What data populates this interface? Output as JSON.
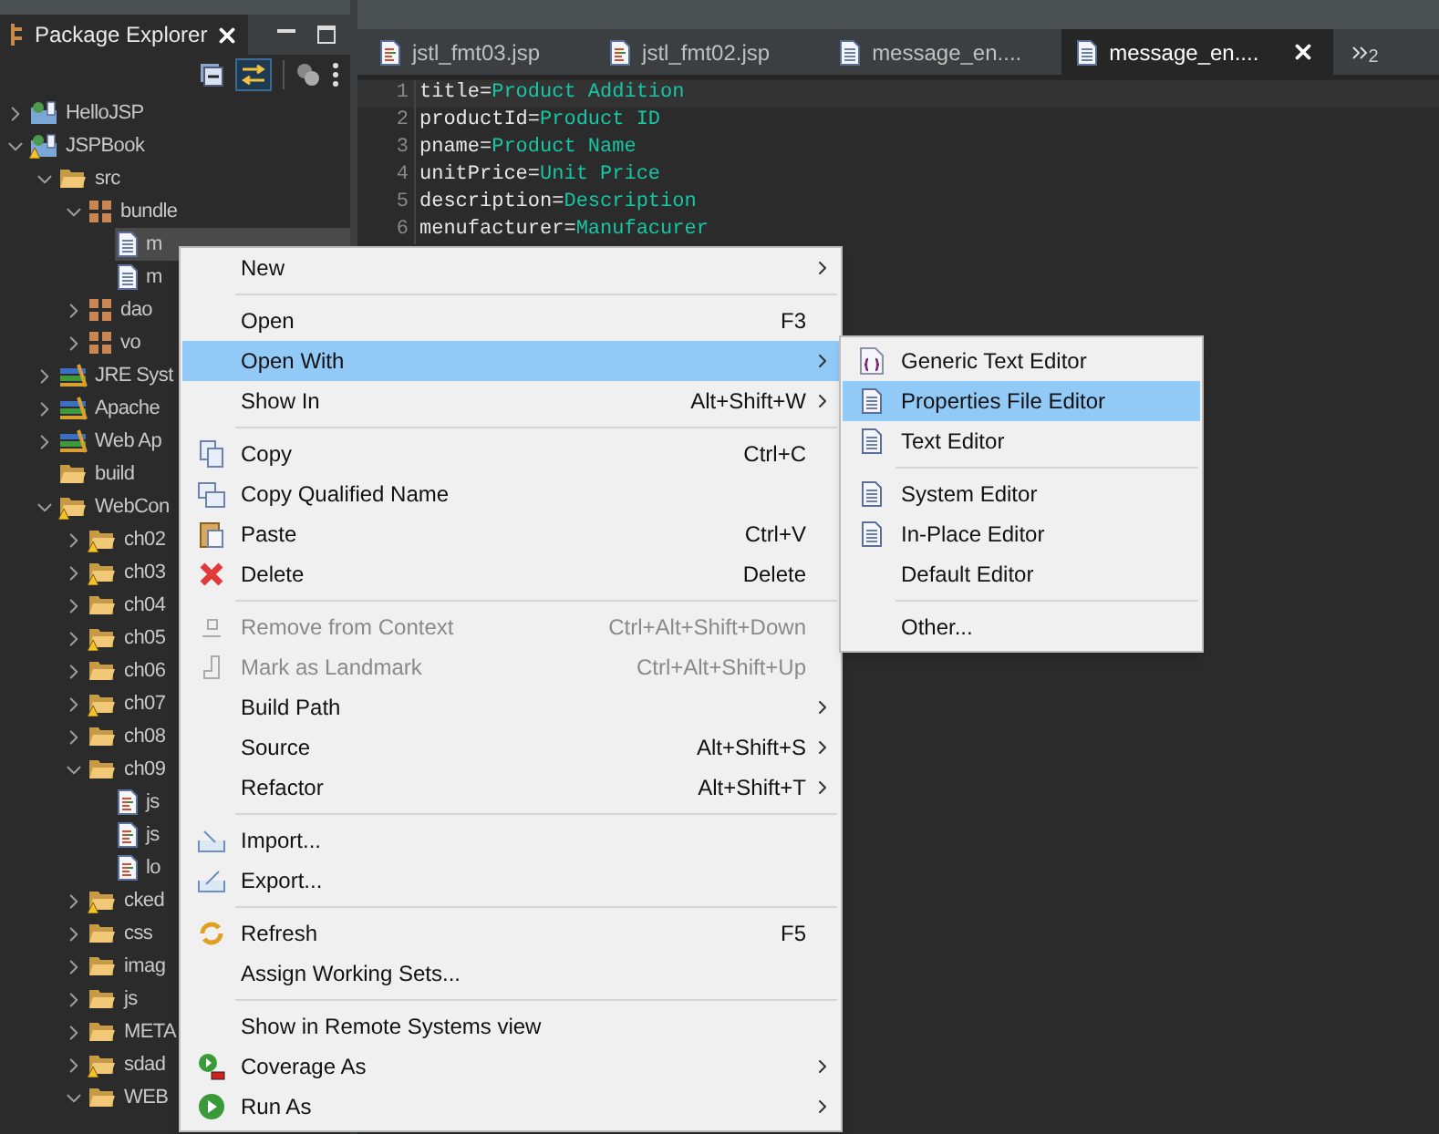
{
  "explorer": {
    "title": "Package Explorer",
    "tree": [
      {
        "label": "HelloJSP",
        "kind": "project",
        "expanded": false,
        "warning": false,
        "selected": false
      },
      {
        "label": "JSPBook",
        "kind": "project",
        "expanded": true,
        "warning": true,
        "selected": false,
        "children": [
          {
            "label": "src",
            "kind": "source-folder",
            "expanded": true,
            "warning": false,
            "selected": false,
            "children": [
              {
                "label": "bundle",
                "kind": "package",
                "expanded": true,
                "selected": false,
                "children": [
                  {
                    "label": "m",
                    "kind": "properties",
                    "selected": true
                  },
                  {
                    "label": "m",
                    "kind": "properties",
                    "selected": false
                  }
                ]
              },
              {
                "label": "dao",
                "kind": "package",
                "expanded": false,
                "selected": false
              },
              {
                "label": "vo",
                "kind": "package",
                "expanded": false,
                "selected": false
              }
            ]
          },
          {
            "label": "JRE Syst",
            "kind": "library",
            "expanded": false,
            "selected": false
          },
          {
            "label": "Apache",
            "kind": "library",
            "expanded": false,
            "selected": false
          },
          {
            "label": "Web Ap",
            "kind": "library",
            "expanded": false,
            "selected": false
          },
          {
            "label": "build",
            "kind": "folder",
            "warning": false,
            "selected": false
          },
          {
            "label": "WebCon",
            "kind": "folder",
            "expanded": true,
            "warning": true,
            "selected": false,
            "children": [
              {
                "label": "ch02",
                "kind": "folder",
                "expanded": false,
                "warning": true,
                "selected": false
              },
              {
                "label": "ch03",
                "kind": "folder",
                "expanded": false,
                "warning": true,
                "selected": false
              },
              {
                "label": "ch04",
                "kind": "folder",
                "expanded": false,
                "warning": false,
                "selected": false
              },
              {
                "label": "ch05",
                "kind": "folder",
                "expanded": false,
                "warning": true,
                "selected": false
              },
              {
                "label": "ch06",
                "kind": "folder",
                "expanded": false,
                "warning": false,
                "selected": false
              },
              {
                "label": "ch07",
                "kind": "folder",
                "expanded": false,
                "warning": true,
                "selected": false
              },
              {
                "label": "ch08",
                "kind": "folder",
                "expanded": false,
                "warning": false,
                "selected": false
              },
              {
                "label": "ch09",
                "kind": "folder",
                "expanded": true,
                "warning": false,
                "selected": false,
                "children": [
                  {
                    "label": "js",
                    "kind": "jsp",
                    "selected": false
                  },
                  {
                    "label": "js",
                    "kind": "jsp",
                    "selected": false
                  },
                  {
                    "label": "lo",
                    "kind": "jsp",
                    "selected": false
                  }
                ]
              },
              {
                "label": "cked",
                "kind": "folder",
                "expanded": false,
                "warning": true,
                "selected": false
              },
              {
                "label": "css",
                "kind": "folder",
                "expanded": false,
                "warning": false,
                "selected": false
              },
              {
                "label": "imag",
                "kind": "folder",
                "expanded": false,
                "warning": false,
                "selected": false
              },
              {
                "label": "js",
                "kind": "folder",
                "expanded": false,
                "warning": false,
                "selected": false
              },
              {
                "label": "META",
                "kind": "folder",
                "expanded": false,
                "warning": false,
                "selected": false
              },
              {
                "label": "sdad",
                "kind": "folder",
                "expanded": false,
                "warning": true,
                "selected": false
              },
              {
                "label": "WEB",
                "kind": "folder",
                "expanded": true,
                "warning": false,
                "selected": false
              }
            ]
          }
        ]
      }
    ]
  },
  "editor": {
    "tabs": [
      {
        "label": "jstl_fmt03.jsp",
        "kind": "jsp",
        "selected": false
      },
      {
        "label": "jstl_fmt02.jsp",
        "kind": "jsp",
        "selected": false
      },
      {
        "label": "message_en....",
        "kind": "properties",
        "selected": false
      },
      {
        "label": "message_en....",
        "kind": "properties",
        "selected": true
      }
    ],
    "overflow_count": "2",
    "lines": [
      {
        "number": "1",
        "key": "title=",
        "value": "Product Addition"
      },
      {
        "number": "2",
        "key": "productId=",
        "value": "Product ID"
      },
      {
        "number": "3",
        "key": "pname=",
        "value": "Product Name"
      },
      {
        "number": "4",
        "key": "unitPrice=",
        "value": "Unit Price"
      },
      {
        "number": "5",
        "key": "description=",
        "value": "Description"
      },
      {
        "number": "6",
        "key": "menufacturer=",
        "value": "Manufacurer"
      }
    ]
  },
  "context_menu": {
    "items": [
      {
        "kind": "item",
        "label": "New",
        "submenu": true,
        "disabled": false,
        "selected": false
      },
      {
        "kind": "separator"
      },
      {
        "kind": "item",
        "label": "Open",
        "shortcut": "F3",
        "submenu": false,
        "disabled": false,
        "selected": false
      },
      {
        "kind": "item",
        "label": "Open With",
        "submenu": true,
        "disabled": false,
        "selected": true
      },
      {
        "kind": "item",
        "label": "Show In",
        "shortcut": "Alt+Shift+W",
        "submenu": true,
        "disabled": false,
        "selected": false
      },
      {
        "kind": "separator"
      },
      {
        "kind": "item",
        "label": "Copy",
        "shortcut": "Ctrl+C",
        "submenu": false,
        "disabled": false,
        "selected": false
      },
      {
        "kind": "item",
        "label": "Copy Qualified Name",
        "submenu": false,
        "disabled": false,
        "selected": false
      },
      {
        "kind": "item",
        "label": "Paste",
        "shortcut": "Ctrl+V",
        "submenu": false,
        "disabled": false,
        "selected": false
      },
      {
        "kind": "item",
        "label": "Delete",
        "shortcut": "Delete",
        "submenu": false,
        "disabled": false,
        "selected": false
      },
      {
        "kind": "separator"
      },
      {
        "kind": "item",
        "label": "Remove from Context",
        "shortcut": "Ctrl+Alt+Shift+Down",
        "submenu": false,
        "disabled": true,
        "selected": false
      },
      {
        "kind": "item",
        "label": "Mark as Landmark",
        "shortcut": "Ctrl+Alt+Shift+Up",
        "submenu": false,
        "disabled": true,
        "selected": false
      },
      {
        "kind": "item",
        "label": "Build Path",
        "submenu": true,
        "disabled": false,
        "selected": false
      },
      {
        "kind": "item",
        "label": "Source",
        "shortcut": "Alt+Shift+S",
        "submenu": true,
        "disabled": false,
        "selected": false
      },
      {
        "kind": "item",
        "label": "Refactor",
        "shortcut": "Alt+Shift+T",
        "submenu": true,
        "disabled": false,
        "selected": false
      },
      {
        "kind": "separator"
      },
      {
        "kind": "item",
        "label": "Import...",
        "submenu": false,
        "disabled": false,
        "selected": false
      },
      {
        "kind": "item",
        "label": "Export...",
        "submenu": false,
        "disabled": false,
        "selected": false
      },
      {
        "kind": "separator"
      },
      {
        "kind": "item",
        "label": "Refresh",
        "shortcut": "F5",
        "submenu": false,
        "disabled": false,
        "selected": false
      },
      {
        "kind": "item",
        "label": "Assign Working Sets...",
        "submenu": false,
        "disabled": false,
        "selected": false
      },
      {
        "kind": "separator"
      },
      {
        "kind": "item",
        "label": "Show in Remote Systems view",
        "submenu": false,
        "disabled": false,
        "selected": false
      },
      {
        "kind": "item",
        "label": "Coverage As",
        "submenu": true,
        "disabled": false,
        "selected": false
      },
      {
        "kind": "item",
        "label": "Run As",
        "submenu": true,
        "disabled": false,
        "selected": false
      }
    ]
  },
  "submenu": {
    "items": [
      {
        "kind": "item",
        "label": "Generic Text Editor",
        "selected": false
      },
      {
        "kind": "item",
        "label": "Properties File Editor",
        "selected": true
      },
      {
        "kind": "item",
        "label": "Text Editor",
        "selected": false
      },
      {
        "kind": "separator"
      },
      {
        "kind": "item",
        "label": "System Editor",
        "selected": false
      },
      {
        "kind": "item",
        "label": "In-Place Editor",
        "selected": false
      },
      {
        "kind": "item",
        "label": "Default Editor",
        "selected": false
      },
      {
        "kind": "separator"
      },
      {
        "kind": "item",
        "label": "Other...",
        "selected": false
      }
    ]
  }
}
